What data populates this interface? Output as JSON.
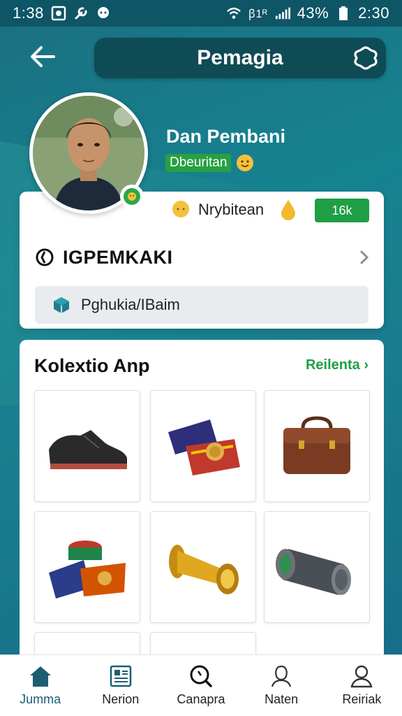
{
  "status_bar": {
    "time": "1:38",
    "signal_text": "ꞵ1ᴿ",
    "battery": "43%",
    "clock_right": "2:30"
  },
  "header": {
    "title": "Pemagia"
  },
  "profile": {
    "name": "Dan Pembani",
    "subtitle": "Dbeuritan",
    "stat_label": "Nrybitean",
    "stat_value": "16k",
    "section_link": "IGPEMKAKI",
    "info_field": "Pghukia/IBaim"
  },
  "collection": {
    "title": "Kolextio Anp",
    "more_link": "Reilenta"
  },
  "bottom_nav": {
    "items": [
      {
        "label": "Jumma",
        "icon": "home-icon"
      },
      {
        "label": "Nerion",
        "icon": "news-icon"
      },
      {
        "label": "Canapra",
        "icon": "search-icon"
      },
      {
        "label": "Naten",
        "icon": "user-outline-icon"
      },
      {
        "label": "Reiriak",
        "icon": "profile-icon"
      }
    ]
  },
  "colors": {
    "accent": "#1f9e45",
    "header_pill": "#0f4b55",
    "background": "#168391"
  }
}
